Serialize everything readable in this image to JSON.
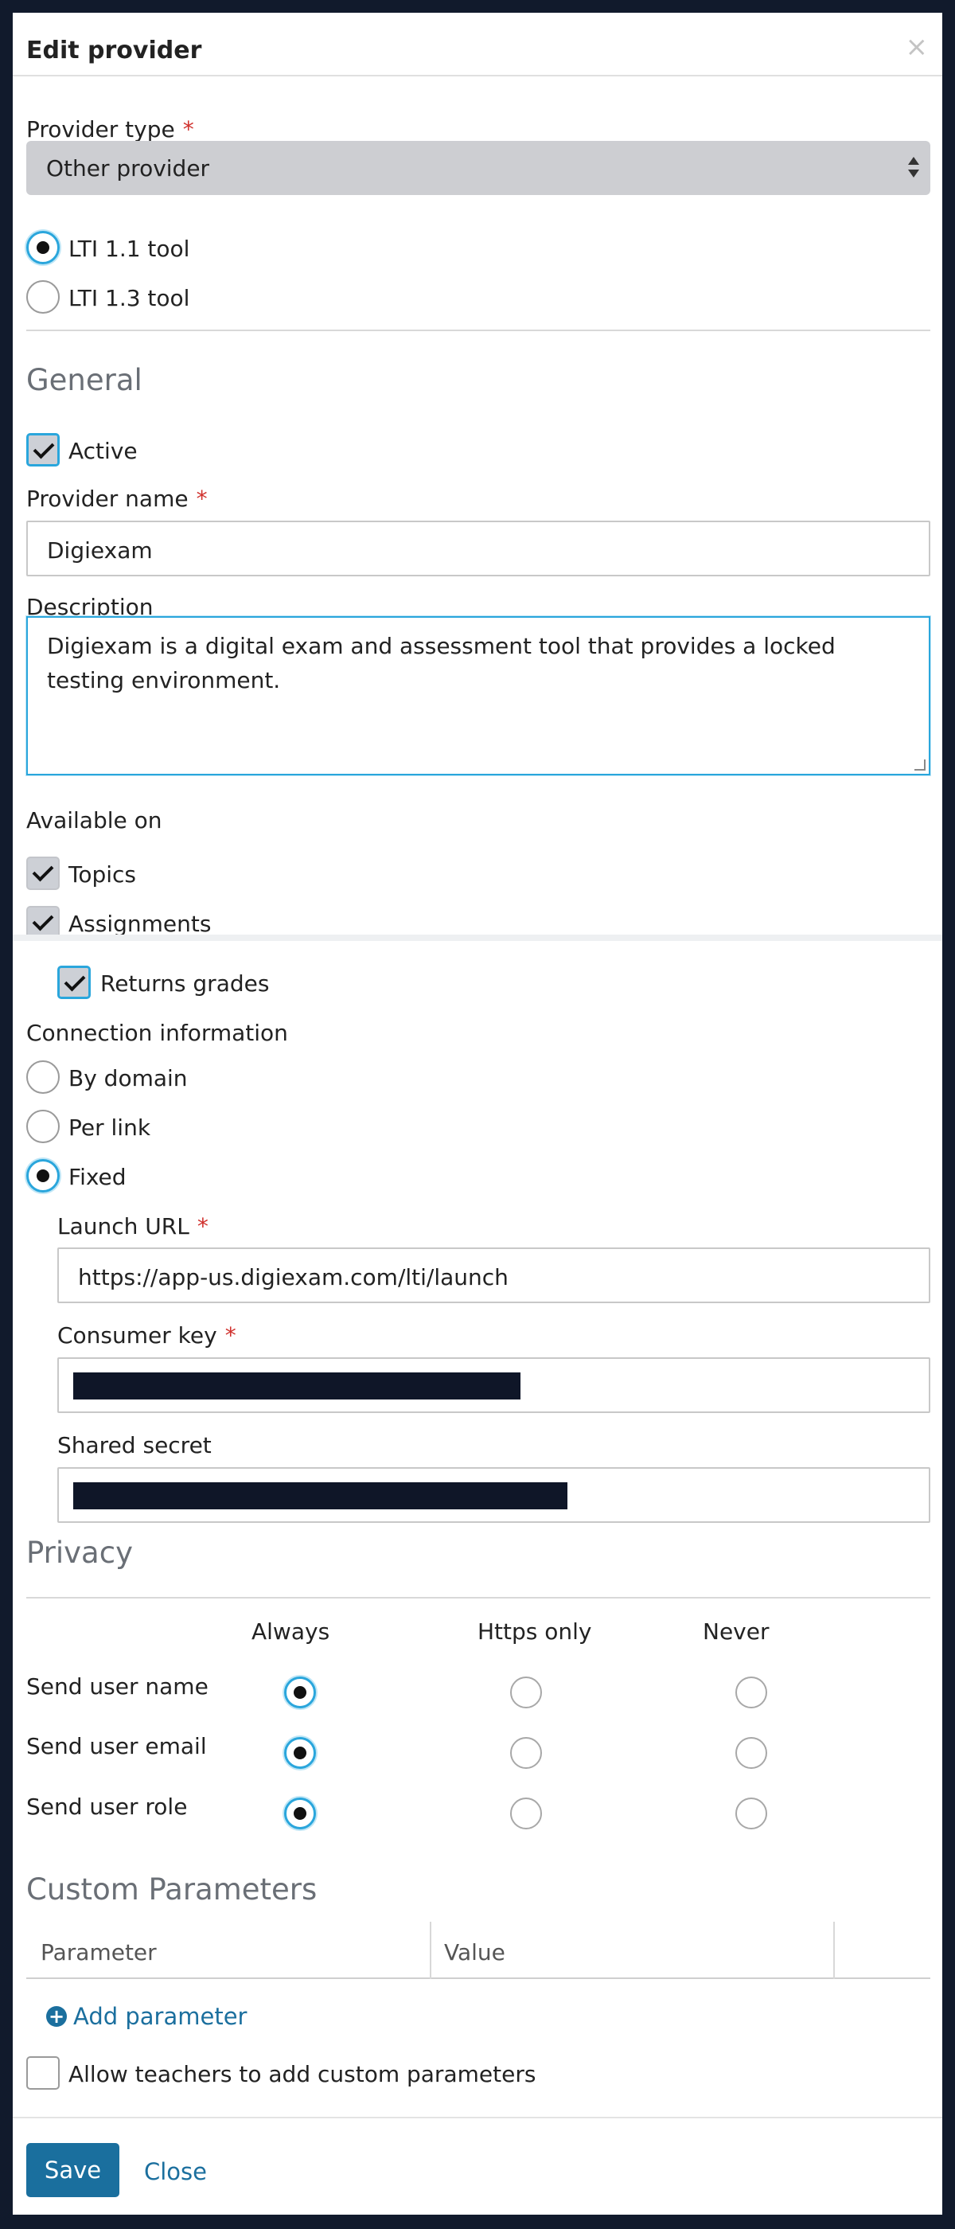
{
  "dialog": {
    "title": "Edit provider",
    "close_icon": "close-icon"
  },
  "provider_type": {
    "label": "Provider type",
    "required_mark": "*",
    "selected": "Other provider",
    "options": [
      {
        "label": "LTI 1.1 tool",
        "checked": true
      },
      {
        "label": "LTI 1.3 tool",
        "checked": false
      }
    ]
  },
  "general": {
    "title": "General",
    "active_label": "Active",
    "active": true,
    "provider_name_label": "Provider name",
    "provider_name_required": "*",
    "provider_name_value": "Digiexam",
    "description_label": "Description",
    "description_value": "Digiexam is a digital exam and assessment tool that provides a locked testing environment.",
    "available_on_label": "Available on",
    "available_on": [
      {
        "label": "Topics",
        "checked": true
      },
      {
        "label": "Assignments",
        "checked": true
      }
    ],
    "returns_grades_label": "Returns grades",
    "returns_grades": true
  },
  "connection": {
    "label": "Connection information",
    "options": [
      {
        "label": "By domain",
        "checked": false
      },
      {
        "label": "Per link",
        "checked": false
      },
      {
        "label": "Fixed",
        "checked": true
      }
    ],
    "launch_url_label": "Launch URL",
    "launch_url_required": "*",
    "launch_url_value": "https://app-us.digiexam.com/lti/launch",
    "consumer_key_label": "Consumer key",
    "consumer_key_required": "*",
    "shared_secret_label": "Shared secret"
  },
  "privacy": {
    "title": "Privacy",
    "columns": [
      "Always",
      "Https only",
      "Never"
    ],
    "rows": [
      {
        "label": "Send user name",
        "selected": 0
      },
      {
        "label": "Send user email",
        "selected": 0
      },
      {
        "label": "Send user role",
        "selected": 0
      }
    ]
  },
  "custom_parameters": {
    "title": "Custom Parameters",
    "col_parameter": "Parameter",
    "col_value": "Value",
    "add_label": "Add parameter",
    "allow_label": "Allow teachers to add custom parameters",
    "allow": false
  },
  "footer": {
    "save_label": "Save",
    "close_label": "Close"
  },
  "colors": {
    "accent": "#2aa6dc",
    "link": "#1b6f9e",
    "primary_button": "#1a6f9e",
    "required": "#d0312d"
  }
}
